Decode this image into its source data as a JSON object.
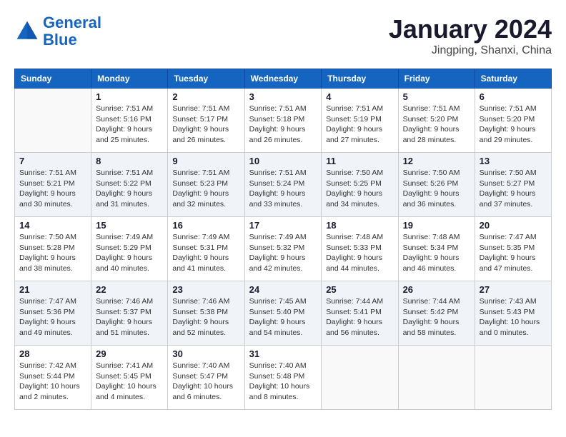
{
  "header": {
    "logo_line1": "General",
    "logo_line2": "Blue",
    "month": "January 2024",
    "location": "Jingping, Shanxi, China"
  },
  "days_of_week": [
    "Sunday",
    "Monday",
    "Tuesday",
    "Wednesday",
    "Thursday",
    "Friday",
    "Saturday"
  ],
  "weeks": [
    [
      {
        "day": null
      },
      {
        "day": "1",
        "sunrise": "7:51 AM",
        "sunset": "5:16 PM",
        "daylight": "9 hours and 25 minutes."
      },
      {
        "day": "2",
        "sunrise": "7:51 AM",
        "sunset": "5:17 PM",
        "daylight": "9 hours and 26 minutes."
      },
      {
        "day": "3",
        "sunrise": "7:51 AM",
        "sunset": "5:18 PM",
        "daylight": "9 hours and 26 minutes."
      },
      {
        "day": "4",
        "sunrise": "7:51 AM",
        "sunset": "5:19 PM",
        "daylight": "9 hours and 27 minutes."
      },
      {
        "day": "5",
        "sunrise": "7:51 AM",
        "sunset": "5:20 PM",
        "daylight": "9 hours and 28 minutes."
      },
      {
        "day": "6",
        "sunrise": "7:51 AM",
        "sunset": "5:20 PM",
        "daylight": "9 hours and 29 minutes."
      }
    ],
    [
      {
        "day": "7",
        "sunrise": "7:51 AM",
        "sunset": "5:21 PM",
        "daylight": "9 hours and 30 minutes."
      },
      {
        "day": "8",
        "sunrise": "7:51 AM",
        "sunset": "5:22 PM",
        "daylight": "9 hours and 31 minutes."
      },
      {
        "day": "9",
        "sunrise": "7:51 AM",
        "sunset": "5:23 PM",
        "daylight": "9 hours and 32 minutes."
      },
      {
        "day": "10",
        "sunrise": "7:51 AM",
        "sunset": "5:24 PM",
        "daylight": "9 hours and 33 minutes."
      },
      {
        "day": "11",
        "sunrise": "7:50 AM",
        "sunset": "5:25 PM",
        "daylight": "9 hours and 34 minutes."
      },
      {
        "day": "12",
        "sunrise": "7:50 AM",
        "sunset": "5:26 PM",
        "daylight": "9 hours and 36 minutes."
      },
      {
        "day": "13",
        "sunrise": "7:50 AM",
        "sunset": "5:27 PM",
        "daylight": "9 hours and 37 minutes."
      }
    ],
    [
      {
        "day": "14",
        "sunrise": "7:50 AM",
        "sunset": "5:28 PM",
        "daylight": "9 hours and 38 minutes."
      },
      {
        "day": "15",
        "sunrise": "7:49 AM",
        "sunset": "5:29 PM",
        "daylight": "9 hours and 40 minutes."
      },
      {
        "day": "16",
        "sunrise": "7:49 AM",
        "sunset": "5:31 PM",
        "daylight": "9 hours and 41 minutes."
      },
      {
        "day": "17",
        "sunrise": "7:49 AM",
        "sunset": "5:32 PM",
        "daylight": "9 hours and 42 minutes."
      },
      {
        "day": "18",
        "sunrise": "7:48 AM",
        "sunset": "5:33 PM",
        "daylight": "9 hours and 44 minutes."
      },
      {
        "day": "19",
        "sunrise": "7:48 AM",
        "sunset": "5:34 PM",
        "daylight": "9 hours and 46 minutes."
      },
      {
        "day": "20",
        "sunrise": "7:47 AM",
        "sunset": "5:35 PM",
        "daylight": "9 hours and 47 minutes."
      }
    ],
    [
      {
        "day": "21",
        "sunrise": "7:47 AM",
        "sunset": "5:36 PM",
        "daylight": "9 hours and 49 minutes."
      },
      {
        "day": "22",
        "sunrise": "7:46 AM",
        "sunset": "5:37 PM",
        "daylight": "9 hours and 51 minutes."
      },
      {
        "day": "23",
        "sunrise": "7:46 AM",
        "sunset": "5:38 PM",
        "daylight": "9 hours and 52 minutes."
      },
      {
        "day": "24",
        "sunrise": "7:45 AM",
        "sunset": "5:40 PM",
        "daylight": "9 hours and 54 minutes."
      },
      {
        "day": "25",
        "sunrise": "7:44 AM",
        "sunset": "5:41 PM",
        "daylight": "9 hours and 56 minutes."
      },
      {
        "day": "26",
        "sunrise": "7:44 AM",
        "sunset": "5:42 PM",
        "daylight": "9 hours and 58 minutes."
      },
      {
        "day": "27",
        "sunrise": "7:43 AM",
        "sunset": "5:43 PM",
        "daylight": "10 hours and 0 minutes."
      }
    ],
    [
      {
        "day": "28",
        "sunrise": "7:42 AM",
        "sunset": "5:44 PM",
        "daylight": "10 hours and 2 minutes."
      },
      {
        "day": "29",
        "sunrise": "7:41 AM",
        "sunset": "5:45 PM",
        "daylight": "10 hours and 4 minutes."
      },
      {
        "day": "30",
        "sunrise": "7:40 AM",
        "sunset": "5:47 PM",
        "daylight": "10 hours and 6 minutes."
      },
      {
        "day": "31",
        "sunrise": "7:40 AM",
        "sunset": "5:48 PM",
        "daylight": "10 hours and 8 minutes."
      },
      {
        "day": null
      },
      {
        "day": null
      },
      {
        "day": null
      }
    ]
  ]
}
